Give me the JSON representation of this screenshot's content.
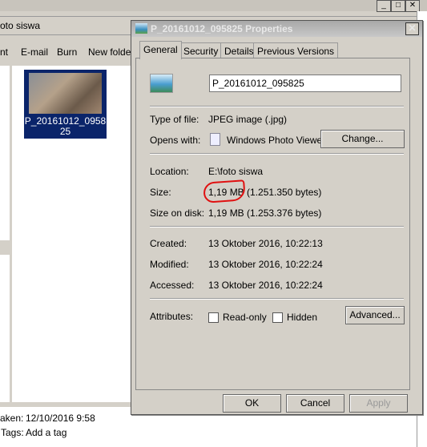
{
  "explorer": {
    "address": "oto siswa",
    "toolbar": [
      "nt",
      "E-mail",
      "Burn",
      "New folder"
    ],
    "file_name": "P_20161012_095825",
    "file_label_line1": "P_20161012_0958",
    "file_label_line2": "25",
    "details": {
      "taken_label": "aken:",
      "taken_value": "12/10/2016 9:58",
      "tags_label": "Tags:",
      "tags_value": "Add a tag"
    }
  },
  "dialog": {
    "title": "P_20161012_095825 Properties",
    "tabs": [
      "General",
      "Security",
      "Details",
      "Previous Versions"
    ],
    "active_tab": "General",
    "file_name_value": "P_20161012_095825",
    "rows": {
      "type_label": "Type of file:",
      "type_value": "JPEG image (.jpg)",
      "opens_label": "Opens with:",
      "opens_value": "Windows Photo Viewer",
      "change_button": "Change...",
      "location_label": "Location:",
      "location_value": "E:\\foto siswa",
      "size_label": "Size:",
      "size_value": "1,19 MB (1.251.350 bytes)",
      "size_on_disk_label": "Size on disk:",
      "size_on_disk_value": "1,19 MB (1.253.376 bytes)",
      "created_label": "Created:",
      "created_value": "13 Oktober 2016, 10:22:13",
      "modified_label": "Modified:",
      "modified_value": "13 Oktober 2016, 10:22:24",
      "accessed_label": "Accessed:",
      "accessed_value": "13 Oktober 2016, 10:22:24",
      "attributes_label": "Attributes:",
      "readonly_label": "Read-only",
      "readonly_checked": false,
      "hidden_label": "Hidden",
      "hidden_checked": false,
      "advanced_button": "Advanced..."
    },
    "buttons": {
      "ok": "OK",
      "cancel": "Cancel",
      "apply": "Apply"
    },
    "annotation_color": "#e01010"
  }
}
